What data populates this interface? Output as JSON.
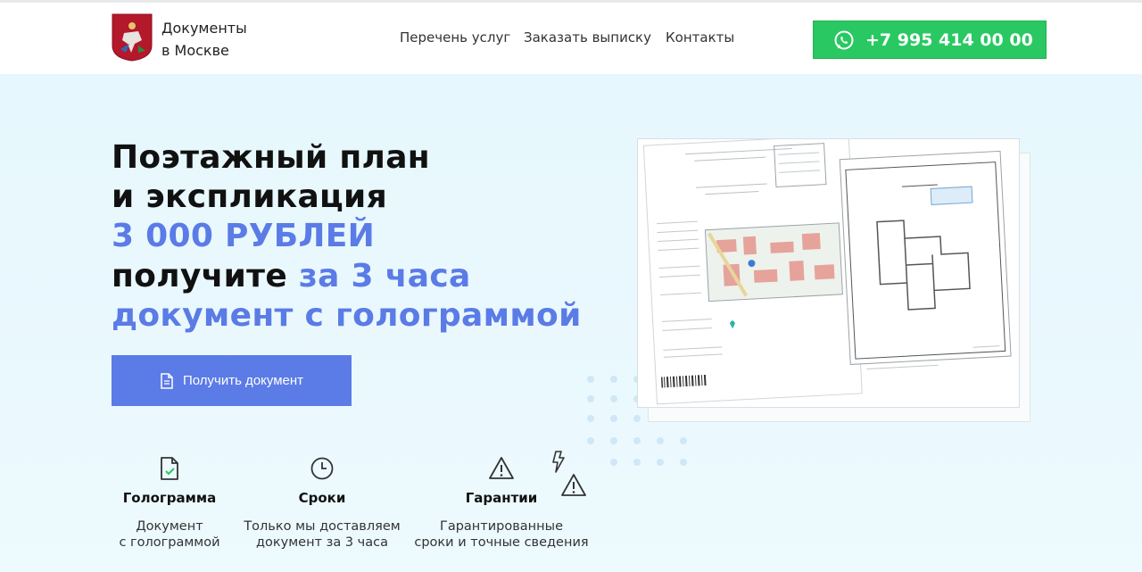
{
  "header": {
    "brand_line1": "Документы",
    "brand_line2": "в Москве",
    "nav": [
      "Перечень услуг",
      "Заказать выписку",
      "Контакты"
    ],
    "phone": "+7 995 414 00 00",
    "phone_icon": "whatsapp-icon",
    "logo": "moscow-coat-of-arms"
  },
  "hero": {
    "line1": "Поэтажный план",
    "line2": "и экспликация",
    "price": "3 000 РУБЛЕЙ",
    "line4_a": "получите ",
    "line4_b": "за 3 часа",
    "line5": "документ с голограммой",
    "cta_label": "Получить документ",
    "cta_icon": "document-icon"
  },
  "features": [
    {
      "icon": "document-check-icon",
      "title": "Голограмма",
      "desc1": "Документ",
      "desc2": "с голограммой"
    },
    {
      "icon": "clock-icon",
      "title": "Сроки",
      "desc1": "Только мы доставляем",
      "desc2": "документ за 3 часа"
    },
    {
      "icon": "warning-icon",
      "title": "Гарантии",
      "desc1": "Гарантированные",
      "desc2": "сроки и точные сведения"
    }
  ],
  "decor_icons": [
    "lightning-icon",
    "warning-icon"
  ],
  "colors": {
    "accent": "#5b7be6",
    "green": "#29c862",
    "bg": "#ecf9fd"
  }
}
